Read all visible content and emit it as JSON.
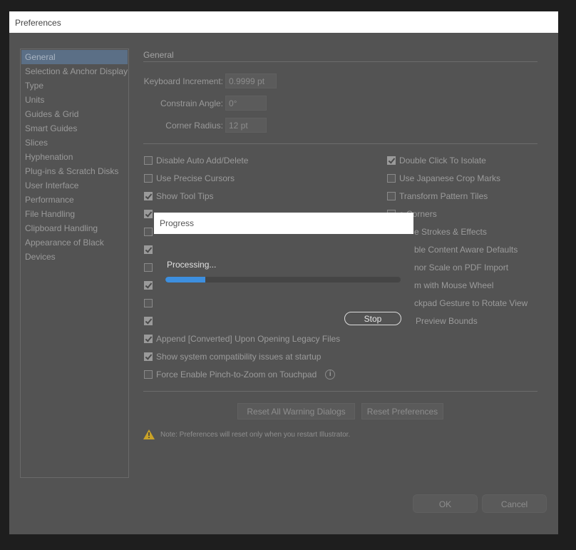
{
  "window": {
    "title": "Preferences"
  },
  "sidebar": {
    "items": [
      {
        "label": "General",
        "selected": true
      },
      {
        "label": "Selection & Anchor Display"
      },
      {
        "label": "Type"
      },
      {
        "label": "Units"
      },
      {
        "label": "Guides & Grid"
      },
      {
        "label": "Smart Guides"
      },
      {
        "label": "Slices"
      },
      {
        "label": "Hyphenation"
      },
      {
        "label": "Plug-ins & Scratch Disks"
      },
      {
        "label": "User Interface"
      },
      {
        "label": "Performance"
      },
      {
        "label": "File Handling"
      },
      {
        "label": "Clipboard Handling"
      },
      {
        "label": "Appearance of Black"
      },
      {
        "label": "Devices"
      }
    ]
  },
  "general": {
    "title": "General",
    "keyboard_increment": {
      "label": "Keyboard Increment:",
      "value": "0.9999 pt"
    },
    "constrain_angle": {
      "label": "Constrain Angle:",
      "value": "0°"
    },
    "corner_radius": {
      "label": "Corner Radius:",
      "value": "12 pt"
    },
    "left_options": [
      {
        "label": "Disable Auto Add/Delete",
        "checked": false
      },
      {
        "label": "Use Precise Cursors",
        "checked": false
      },
      {
        "label": "Show Tool Tips",
        "checked": true
      },
      {
        "label": "",
        "checked": true
      },
      {
        "label": "",
        "checked": false
      },
      {
        "label": "",
        "checked": true
      },
      {
        "label": "",
        "checked": false
      },
      {
        "label": "",
        "checked": true
      },
      {
        "label": "",
        "checked": false
      },
      {
        "label": "",
        "checked": true
      },
      {
        "label": "Append [Converted] Upon Opening Legacy Files",
        "checked": true
      },
      {
        "label": "Show system compatibility issues at startup",
        "checked": true
      },
      {
        "label": "Force Enable Pinch-to-Zoom on Touchpad",
        "checked": false
      }
    ],
    "right_options": [
      {
        "label": "Double Click To Isolate",
        "checked": true
      },
      {
        "label": "Use Japanese Crop Marks",
        "checked": false
      },
      {
        "label": "Transform Pattern Tiles",
        "checked": false
      }
    ],
    "right_partial_labels": [
      "e Corners",
      "e Strokes & Effects",
      "ble Content Aware Defaults",
      "nor Scale on PDF Import",
      "m with Mouse Wheel",
      "ckpad Gesture to Rotate View",
      "Preview Bounds"
    ],
    "reset_warnings_button": "Reset All Warning Dialogs",
    "reset_prefs_button": "Reset Preferences",
    "note": "Note:  Preferences will reset only when you restart Illustrator."
  },
  "footer": {
    "ok": "OK",
    "cancel": "Cancel"
  },
  "progress": {
    "title": "Progress",
    "status": "Processing...",
    "fraction": 0.17,
    "stop": "Stop",
    "fill_color": "#3d8fdf"
  },
  "icons": {
    "info": "info-icon",
    "warning": "warning-icon"
  }
}
